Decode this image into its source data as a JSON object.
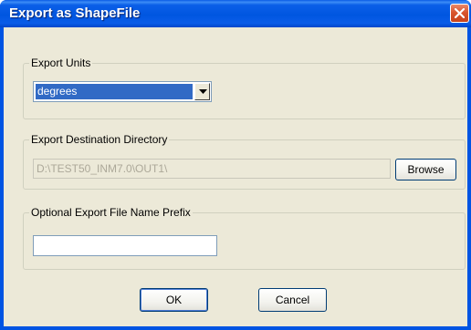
{
  "window": {
    "title": "Export as ShapeFile"
  },
  "export_units": {
    "legend": "Export Units",
    "selected": "degrees"
  },
  "destination": {
    "legend": "Export Destination Directory",
    "path": "D:\\TEST50_INM7.0\\OUT1\\",
    "browse_label": "Browse"
  },
  "prefix": {
    "legend": "Optional Export File Name Prefix",
    "value": ""
  },
  "buttons": {
    "ok_label": "OK",
    "cancel_label": "Cancel"
  },
  "icons": {
    "close": "close-icon",
    "dropdown": "chevron-down-icon"
  },
  "colors": {
    "titlebar": "#0054e3",
    "close_button": "#d9552e",
    "dialog_face": "#ece9d8",
    "selection": "#316ac5"
  }
}
